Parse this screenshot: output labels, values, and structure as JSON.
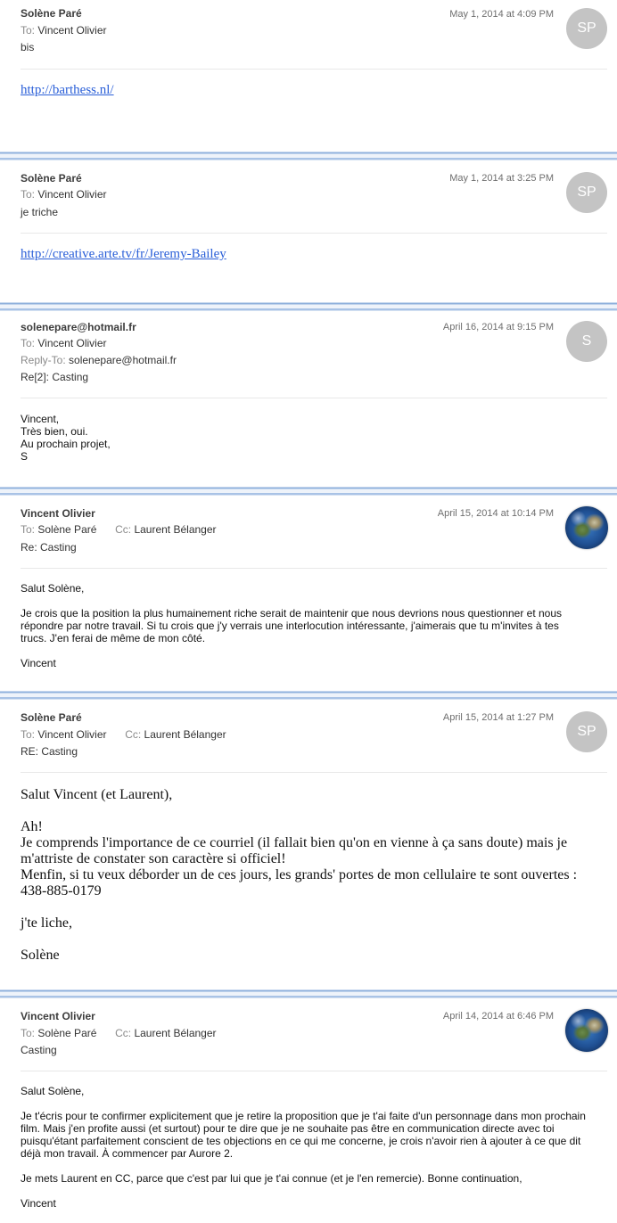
{
  "messages": [
    {
      "sender": "Solène Paré",
      "date": "May 1, 2014 at 4:09 PM",
      "to_key": "To:",
      "to": "Vincent Olivier",
      "subject": "bis",
      "avatar_initials": "SP",
      "link": "http://barthess.nl/"
    },
    {
      "sender": "Solène Paré",
      "date": "May 1, 2014 at 3:25 PM",
      "to_key": "To:",
      "to": "Vincent Olivier",
      "subject": "je triche",
      "avatar_initials": "SP",
      "link": "http://creative.arte.tv/fr/Jeremy-Bailey"
    },
    {
      "sender": "solenepare@hotmail.fr",
      "date": "April 16, 2014 at 9:15 PM",
      "to_key": "To:",
      "to": "Vincent Olivier",
      "replyto_key": "Reply-To:",
      "replyto": "solenepare@hotmail.fr",
      "subject": "Re[2]: Casting",
      "avatar_initials": "S",
      "body": [
        "Vincent,",
        "Très bien, oui.",
        "Au prochain projet,",
        "S"
      ]
    },
    {
      "sender": "Vincent Olivier",
      "date": "April 15, 2014 at 10:14 PM",
      "to_key": "To:",
      "to": "Solène Paré",
      "cc_key": "Cc:",
      "cc": "Laurent Bélanger",
      "subject": "Re: Casting",
      "avatar": "globe-icon",
      "body": [
        "Salut Solène,",
        "Je crois que la position la plus humainement riche serait de maintenir que nous devrions nous questionner et nous répondre par notre travail. Si tu crois que j'y verrais une interlocution intéressante, j'aimerais que tu m'invites à tes trucs. J'en ferai de même de mon côté.",
        "Vincent"
      ]
    },
    {
      "sender": "Solène Paré",
      "date": "April 15, 2014 at 1:27 PM",
      "to_key": "To:",
      "to": "Vincent Olivier",
      "cc_key": "Cc:",
      "cc": "Laurent Bélanger",
      "subject": "RE: Casting",
      "avatar_initials": "SP",
      "body": [
        "Salut Vincent (et Laurent),",
        "Ah!",
        "Je comprends l'importance de ce courriel (il fallait bien qu'on en vienne à ça sans doute) mais je m'attriste de constater son caractère si officiel!",
        "Menfin, si tu veux déborder un de ces jours, les grands' portes de mon cellulaire te sont ouvertes :",
        "438-885-0179",
        "j'te liche,",
        "Solène"
      ]
    },
    {
      "sender": "Vincent Olivier",
      "date": "April 14, 2014 at 6:46 PM",
      "to_key": "To:",
      "to": "Solène Paré",
      "cc_key": "Cc:",
      "cc": "Laurent Bélanger",
      "subject": "Casting",
      "avatar": "globe-icon",
      "body": [
        "Salut Solène,",
        "Je t'écris pour te confirmer explicitement que je retire la proposition que je t'ai faite d'un personnage dans mon prochain film. Mais j'en profite aussi (et surtout) pour te dire que je ne souhaite pas être en communication directe avec toi puisqu'étant parfaitement conscient de tes objections en ce qui me concerne, je crois n'avoir rien à ajouter à ce que dit déjà mon travail. À commencer par Aurore 2.",
        "Je mets Laurent en CC, parce que c'est par lui que je t'ai connue (et je l'en remercie). Bonne continuation,",
        "Vincent"
      ]
    }
  ]
}
